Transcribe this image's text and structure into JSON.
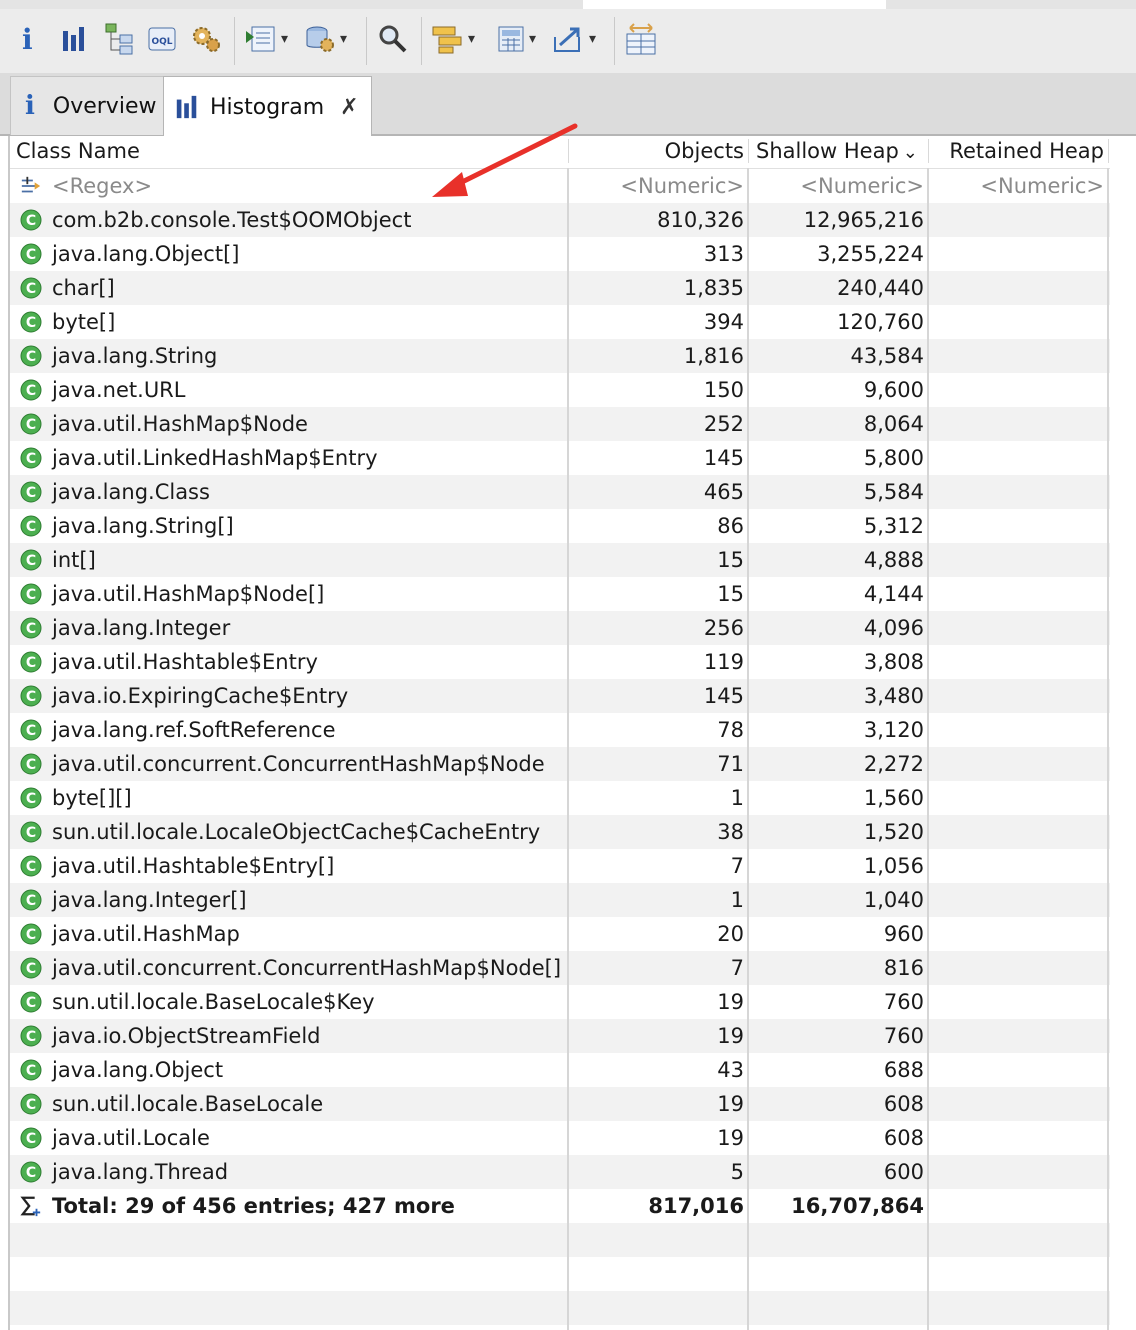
{
  "toolbar": {
    "info_label": "i",
    "tools": [
      "info",
      "histogram",
      "dominator-tree",
      "oql",
      "thread-overview",
      "run-report",
      "query-browser",
      "search",
      "group-by",
      "calculate-retained-size",
      "export",
      "compare-results"
    ]
  },
  "tabs": [
    {
      "icon": "info-icon",
      "label": "Overview",
      "icon_text": "i"
    },
    {
      "icon": "histogram-icon",
      "label": "Histogram",
      "close": "✗"
    }
  ],
  "columns": {
    "class_name": "Class Name",
    "objects": "Objects",
    "shallow_heap": "Shallow Heap",
    "shallow_sort": "⌄",
    "retained_heap": "Retained Heap"
  },
  "filter_row": {
    "class_name": "<Regex>",
    "objects": "<Numeric>",
    "shallow_heap": "<Numeric>",
    "retained_heap": "<Numeric>"
  },
  "rows": [
    {
      "name": "com.b2b.console.Test$OOMObject",
      "objects": "810,326",
      "shallow": "12,965,216"
    },
    {
      "name": "java.lang.Object[]",
      "objects": "313",
      "shallow": "3,255,224"
    },
    {
      "name": "char[]",
      "objects": "1,835",
      "shallow": "240,440"
    },
    {
      "name": "byte[]",
      "objects": "394",
      "shallow": "120,760"
    },
    {
      "name": "java.lang.String",
      "objects": "1,816",
      "shallow": "43,584"
    },
    {
      "name": "java.net.URL",
      "objects": "150",
      "shallow": "9,600"
    },
    {
      "name": "java.util.HashMap$Node",
      "objects": "252",
      "shallow": "8,064"
    },
    {
      "name": "java.util.LinkedHashMap$Entry",
      "objects": "145",
      "shallow": "5,800"
    },
    {
      "name": "java.lang.Class",
      "objects": "465",
      "shallow": "5,584"
    },
    {
      "name": "java.lang.String[]",
      "objects": "86",
      "shallow": "5,312"
    },
    {
      "name": "int[]",
      "objects": "15",
      "shallow": "4,888"
    },
    {
      "name": "java.util.HashMap$Node[]",
      "objects": "15",
      "shallow": "4,144"
    },
    {
      "name": "java.lang.Integer",
      "objects": "256",
      "shallow": "4,096"
    },
    {
      "name": "java.util.Hashtable$Entry",
      "objects": "119",
      "shallow": "3,808"
    },
    {
      "name": "java.io.ExpiringCache$Entry",
      "objects": "145",
      "shallow": "3,480"
    },
    {
      "name": "java.lang.ref.SoftReference",
      "objects": "78",
      "shallow": "3,120"
    },
    {
      "name": "java.util.concurrent.ConcurrentHashMap$Node",
      "objects": "71",
      "shallow": "2,272"
    },
    {
      "name": "byte[][]",
      "objects": "1",
      "shallow": "1,560"
    },
    {
      "name": "sun.util.locale.LocaleObjectCache$CacheEntry",
      "objects": "38",
      "shallow": "1,520"
    },
    {
      "name": "java.util.Hashtable$Entry[]",
      "objects": "7",
      "shallow": "1,056"
    },
    {
      "name": "java.lang.Integer[]",
      "objects": "1",
      "shallow": "1,040"
    },
    {
      "name": "java.util.HashMap",
      "objects": "20",
      "shallow": "960"
    },
    {
      "name": "java.util.concurrent.ConcurrentHashMap$Node[]",
      "objects": "7",
      "shallow": "816"
    },
    {
      "name": "sun.util.locale.BaseLocale$Key",
      "objects": "19",
      "shallow": "760"
    },
    {
      "name": "java.io.ObjectStreamField",
      "objects": "19",
      "shallow": "760"
    },
    {
      "name": "java.lang.Object",
      "objects": "43",
      "shallow": "688"
    },
    {
      "name": "sun.util.locale.BaseLocale",
      "objects": "19",
      "shallow": "608"
    },
    {
      "name": "java.util.Locale",
      "objects": "19",
      "shallow": "608"
    },
    {
      "name": "java.lang.Thread",
      "objects": "5",
      "shallow": "600"
    }
  ],
  "total": {
    "label": "Total: 29 of 456 entries; 427 more",
    "objects": "817,016",
    "shallow": "16,707,864"
  },
  "colors": {
    "class_icon": "#4caf50",
    "annotation_arrow": "#e8312a"
  }
}
